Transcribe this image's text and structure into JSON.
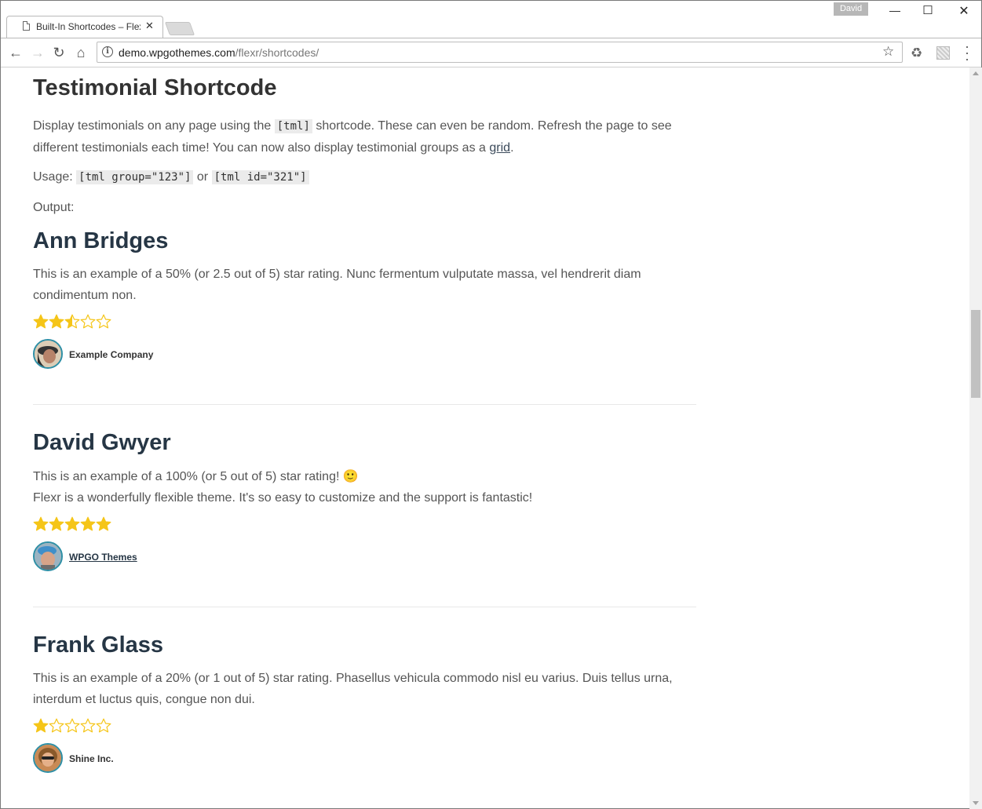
{
  "browser": {
    "tab_title": "Built-In Shortcodes – Flexr",
    "profile_name": "David",
    "url_domain": "demo.wpgothemes.com",
    "url_path": "/flexr/shortcodes/"
  },
  "page": {
    "section_title": "Testimonial Shortcode",
    "intro_text_1": "Display testimonials on any page using the ",
    "intro_code": "[tml]",
    "intro_text_2": " shortcode. These can even be random. Refresh the page to see different testimonials each time! You can now also display testimonial groups as a ",
    "intro_link": "grid",
    "intro_text_3": ".",
    "usage_label": "Usage: ",
    "usage_code_1": "[tml group=\"123\"]",
    "usage_or": " or ",
    "usage_code_2": "[tml id=\"321\"]",
    "output_label": "Output:",
    "testimonials": [
      {
        "name": "Ann Bridges",
        "text": "This is an example of a 50% (or 2.5 out of 5) star rating. Nunc fermentum vulputate massa, vel hendrerit diam condimentum non.",
        "rating": 2.5,
        "company": "Example Company"
      },
      {
        "name": "David Gwyer",
        "text_line_1": "This is an example of a 100% (or 5 out of 5) star rating! ",
        "emoji": "🙂",
        "text_line_2": "Flexr is a wonderfully flexible theme. It's so easy to customize and the support is fantastic!",
        "rating": 5,
        "company": "WPGO Themes"
      },
      {
        "name": "Frank Glass",
        "text": "This is an example of a 20% (or 1 out of 5) star rating. Phasellus vehicula commodo nisl eu varius. Duis tellus urna, interdum et luctus quis, congue non dui.",
        "rating": 1,
        "company": "Shine Inc."
      }
    ]
  },
  "colors": {
    "star": "#f5c518",
    "heading": "#263645",
    "avatar_ring": "#2d8fa6"
  }
}
